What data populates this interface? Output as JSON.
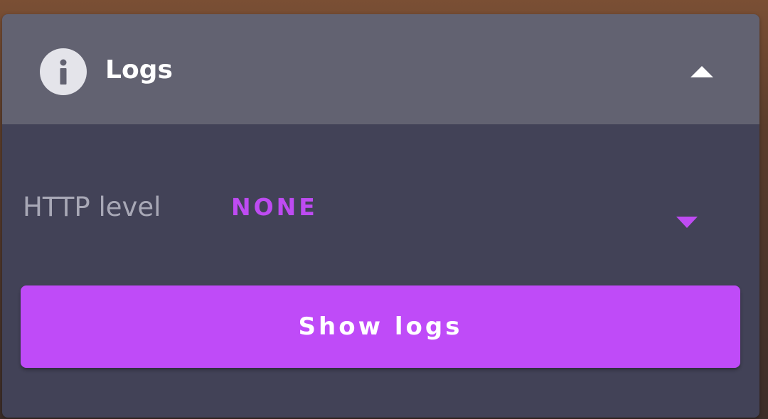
{
  "panel": {
    "title": "Logs",
    "header_icon": "info-icon",
    "collapse_icon": "chevron-up-icon"
  },
  "http_level": {
    "label": "HTTP level",
    "selected_value": "NONE",
    "dropdown_icon": "caret-down-icon"
  },
  "actions": {
    "show_logs_label": "Show logs"
  },
  "colors": {
    "accent": "#bf4bf8",
    "header_bg": "#626271",
    "panel_bg": "#424257",
    "label_text": "#a8a8b6"
  }
}
